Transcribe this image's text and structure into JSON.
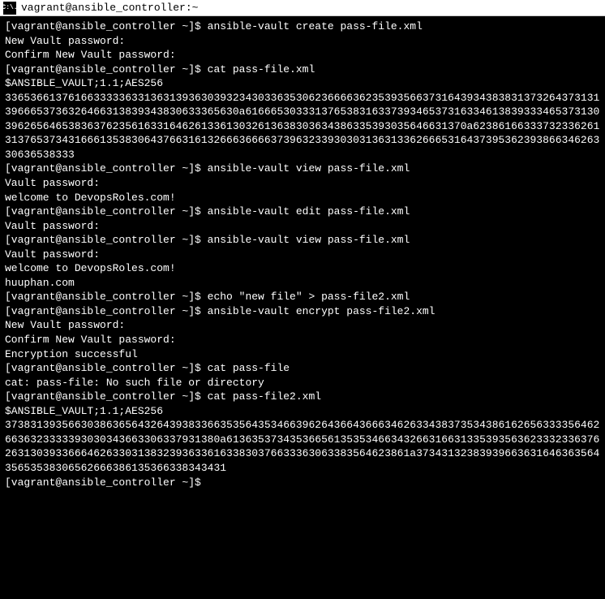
{
  "window": {
    "title": "vagrant@ansible_controller:~"
  },
  "terminal": {
    "prompt": "[vagrant@ansible_controller ~]$ ",
    "lines": [
      {
        "prompt": true,
        "cmd": "ansible-vault create pass-file.xml"
      },
      {
        "text": "New Vault password:"
      },
      {
        "text": "Confirm New Vault password:"
      },
      {
        "prompt": true,
        "cmd": "cat pass-file.xml"
      },
      {
        "text": "$ANSIBLE_VAULT;1.1;AES256"
      },
      {
        "text": "33653661376166333336331363139363039323430336353062366663623539356637316439343838313732643731313966653736326466313839343830633365630a616665303331376538316337393465373163346138393334653731303962656465383637623561633164626133613032613638303634386335393035646631370a62386166333732336261313765373431666135383064376631613266636666373963233930303136313362666531643739536239386634626330636538333"
      },
      {
        "prompt": true,
        "cmd": "ansible-vault view pass-file.xml"
      },
      {
        "text": "Vault password:"
      },
      {
        "text": "welcome to DevopsRoles.com!"
      },
      {
        "prompt": true,
        "cmd": "ansible-vault edit pass-file.xml"
      },
      {
        "text": "Vault password:"
      },
      {
        "prompt": true,
        "cmd": "ansible-vault view pass-file.xml"
      },
      {
        "text": "Vault password:"
      },
      {
        "text": "welcome to DevopsRoles.com!"
      },
      {
        "text": "huuphan.com"
      },
      {
        "prompt": true,
        "cmd": "echo \"new file\" > pass-file2.xml"
      },
      {
        "prompt": true,
        "cmd": "ansible-vault encrypt pass-file2.xml"
      },
      {
        "text": "New Vault password:"
      },
      {
        "text": "Confirm New Vault password:"
      },
      {
        "text": "Encryption successful"
      },
      {
        "prompt": true,
        "cmd": "cat pass-file"
      },
      {
        "text": "cat: pass-file: No such file or directory"
      },
      {
        "prompt": true,
        "cmd": "cat pass-file2.xml"
      },
      {
        "text": "$ANSIBLE_VAULT;1.1;AES256"
      },
      {
        "text": "37383139356630386365643264393833663535643534663962643664366634626334383735343861626563333564626636323333393030343663306337931380a613635373435366561353534663432663166313353935636233323363762631303933666462633031383239363361633830376633363063383564623861a3734313238393966363164636356435653538306562666386135366338343431"
      },
      {
        "prompt": true,
        "cmd": ""
      }
    ]
  }
}
